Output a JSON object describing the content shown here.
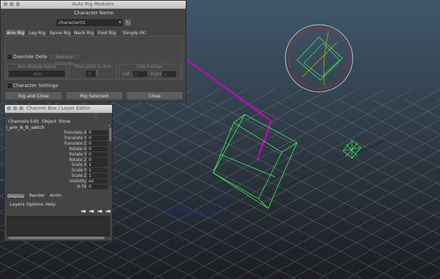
{
  "rig_window": {
    "title": "Auto Rig Modules",
    "character_name_label": "Character Name",
    "character_name_value": "character01",
    "tabs": [
      {
        "label": "Arm Rig"
      },
      {
        "label": "Leg Rig"
      },
      {
        "label": "Spine Rig"
      },
      {
        "label": "Neck Rig"
      },
      {
        "label": "Foot Rig"
      },
      {
        "label": "Simple FK Rig"
      }
    ],
    "override_defaults_label": "Override Defaults",
    "restore_defaults_label": "Restore Defaults",
    "arm_module_name_label": "Arm Module Name",
    "arm_module_name_value": "arm",
    "total_joints_label": "Total Joints In Arm",
    "total_joints_value": "3",
    "side_prefixes_label": "Side Prefixes",
    "left_label": "Left",
    "left_value": "l",
    "right_label": "Right",
    "right_value": "r",
    "character_settings_label": "Character Settings",
    "rig_and_close_label": "Rig and Close",
    "rig_selected_label": "Rig Selected",
    "close_label": "Close"
  },
  "channel_box": {
    "title": "Channel Box / Layer Editor",
    "menu": [
      "Channels",
      "Edit",
      "Object",
      "Show"
    ],
    "object_name": "l_arm_ik_fk_switch",
    "attributes": [
      {
        "name": "Translate X",
        "value": "0"
      },
      {
        "name": "Translate Y",
        "value": "0"
      },
      {
        "name": "Translate Z",
        "value": "0"
      },
      {
        "name": "Rotate X",
        "value": "0"
      },
      {
        "name": "Rotate Y",
        "value": "0"
      },
      {
        "name": "Rotate Z",
        "value": "0"
      },
      {
        "name": "Scale X",
        "value": "1"
      },
      {
        "name": "Scale Y",
        "value": "1"
      },
      {
        "name": "Scale Z",
        "value": "1"
      },
      {
        "name": "Visibility",
        "value": "on"
      },
      {
        "name": "Ik Fk",
        "value": "0"
      }
    ],
    "layer_tabs": [
      "Display",
      "Render",
      "Anim"
    ],
    "layer_menu": [
      "Layers",
      "Options",
      "Help"
    ]
  },
  "colors": {
    "viewport_top": "#3f5164",
    "viewport_bottom": "#1d1f22",
    "grid": "#8e9aa6",
    "control_green": "#3dff5a",
    "joint_magenta": "#cc00cc",
    "selected_red": "#cc2020",
    "circle_white": "#e8e8e8",
    "arrow_blue": "#1a2d88"
  }
}
